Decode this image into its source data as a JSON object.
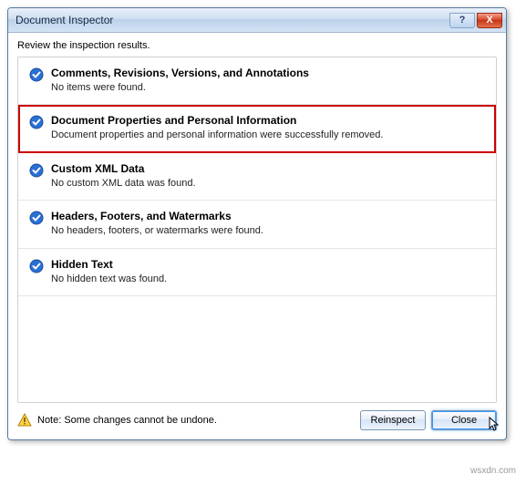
{
  "title": "Document Inspector",
  "instruction": "Review the inspection results.",
  "sections": [
    {
      "title": "Comments, Revisions, Versions, and Annotations",
      "desc": "No items were found."
    },
    {
      "title": "Document Properties and Personal Information",
      "desc": "Document properties and personal information were successfully removed."
    },
    {
      "title": "Custom XML Data",
      "desc": "No custom XML data was found."
    },
    {
      "title": "Headers, Footers, and Watermarks",
      "desc": "No headers, footers, or watermarks were found."
    },
    {
      "title": "Hidden Text",
      "desc": "No hidden text was found."
    }
  ],
  "note": "Note: Some changes cannot be undone.",
  "buttons": {
    "reinspect": "Reinspect",
    "close": "Close"
  },
  "titlebar": {
    "help": "?",
    "close": "X"
  },
  "watermark": "wsxdn.com"
}
